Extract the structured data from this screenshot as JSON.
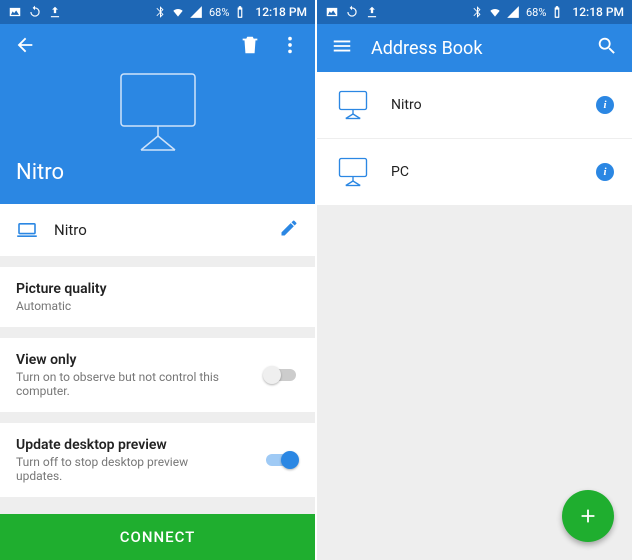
{
  "statusbar": {
    "battery_pct": "68%",
    "time": "12:18 PM"
  },
  "left": {
    "hero_title": "Nitro",
    "device_name": "Nitro",
    "device_sub": "",
    "picture_quality_label": "Picture quality",
    "picture_quality_value": "Automatic",
    "view_only_label": "View only",
    "view_only_desc": "Turn on to observe but not control this computer.",
    "update_label": "Update desktop preview",
    "update_desc": "Turn off to stop desktop preview updates.",
    "connect_label": "CONNECT"
  },
  "right": {
    "title": "Address Book",
    "items": [
      {
        "name": "Nitro"
      },
      {
        "name": "PC"
      }
    ]
  }
}
